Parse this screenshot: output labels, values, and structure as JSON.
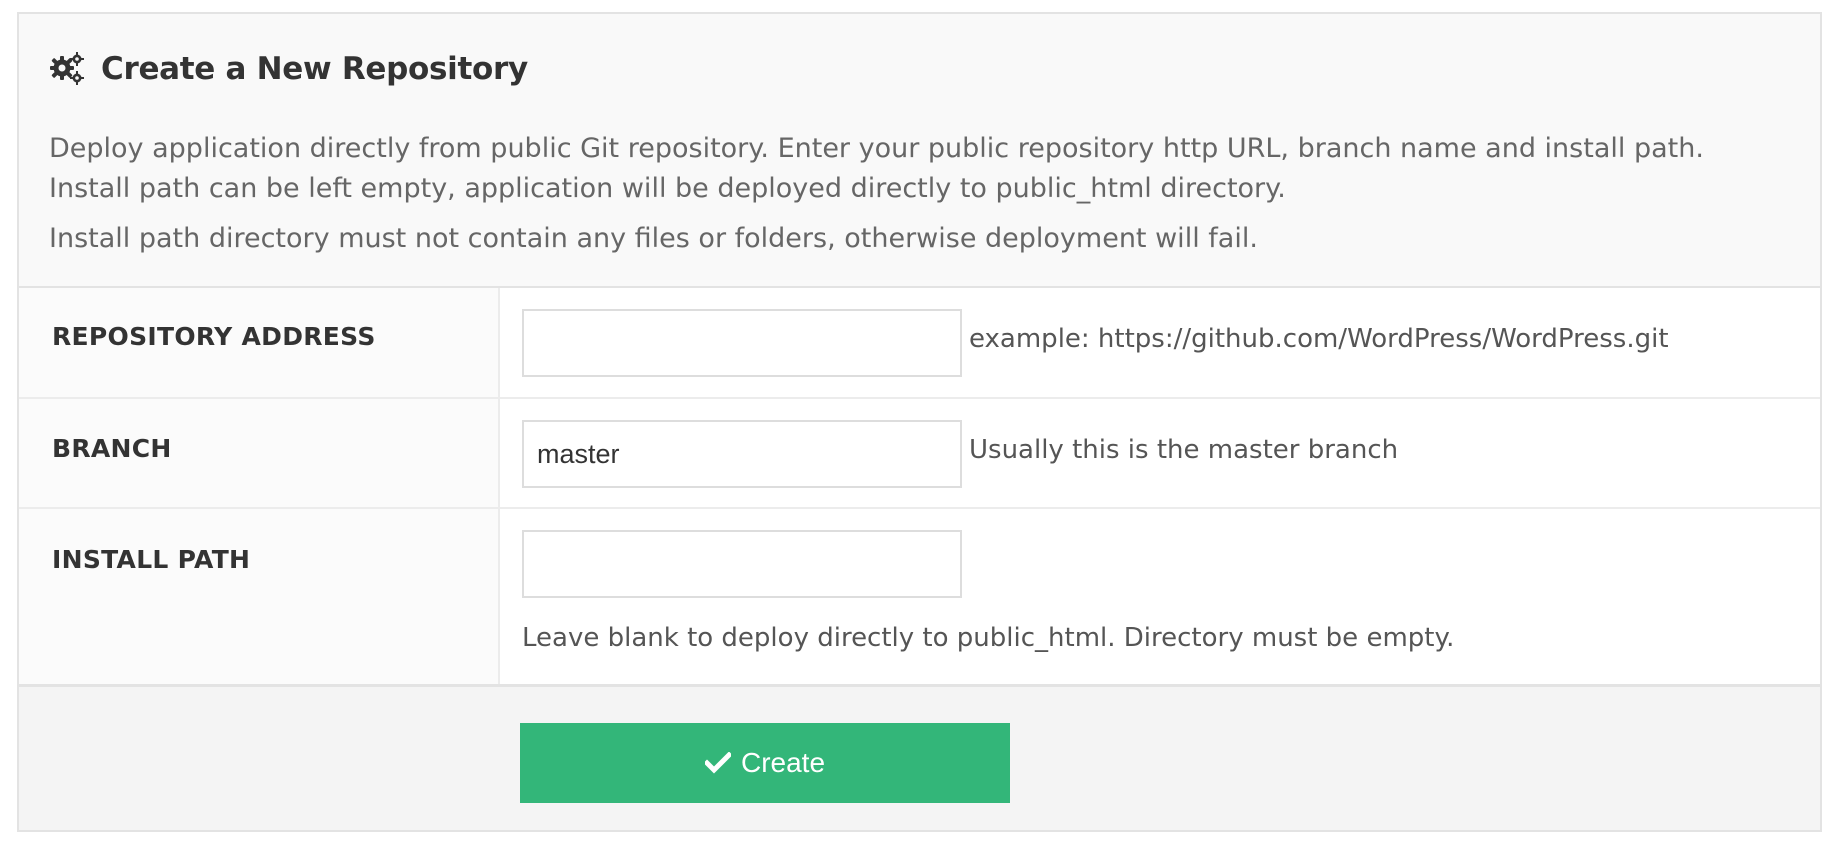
{
  "header": {
    "icon": "gears-icon",
    "title": "Create a New Repository",
    "description_1": "Deploy application directly from public Git repository. Enter your public repository http URL, branch name and install path. Install path can be left empty, application will be deployed directly to public_html directory.",
    "description_2": "Install path directory must not contain any files or folders, otherwise deployment will fail."
  },
  "form": {
    "repository": {
      "label": "REPOSITORY ADDRESS",
      "value": "",
      "hint": "example: https://github.com/WordPress/WordPress.git"
    },
    "branch": {
      "label": "BRANCH",
      "value": "master",
      "hint": "Usually this is the master branch"
    },
    "install_path": {
      "label": "INSTALL PATH",
      "value": "",
      "hint": "Leave blank to deploy directly to public_html. Directory must be empty."
    }
  },
  "actions": {
    "create_label": "Create",
    "create_icon": "check-icon",
    "button_color": "#33b679"
  }
}
